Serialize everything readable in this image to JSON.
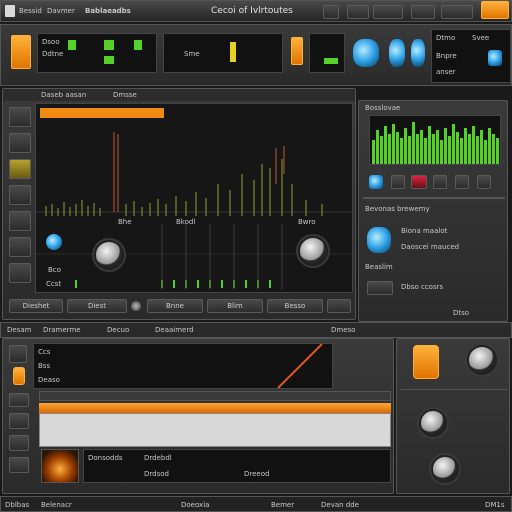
{
  "top_bar": {
    "left_labels": [
      "Bessid",
      "Davmer",
      "Bablaeadbs"
    ],
    "center_title": "Cecoi of Ivlrtoutes"
  },
  "transport": {
    "display_labels": [
      "Dsoo",
      "Ddtne",
      "Sme"
    ],
    "right_display": [
      "Dtmo",
      "Svee",
      "Bnpre",
      "anser"
    ]
  },
  "main_editor": {
    "header_label": "Daseb aasan",
    "header_field": "Dmsse",
    "tab_labels": [
      "Bhe",
      "Bkodl",
      "Bwro"
    ],
    "knob_readouts": [
      "Bco",
      "Ccst"
    ],
    "footer_buttons": [
      "Dieshet",
      "Diest",
      "Bnne",
      "Blim",
      "Besso"
    ]
  },
  "spectrum_panel": {
    "header": "Bosslovae",
    "caption_line1": "Bevonas brewemy",
    "caption_line2": "Biona maalot",
    "caption_line3": "Daoscei mauced",
    "footer_label": "Beaslim",
    "footer_field": "Dbso ccosrs",
    "bottom_label": "Dtso"
  },
  "mixer": {
    "header_labels": [
      "Desam",
      "Dramerme",
      "Decuo",
      "Deaaimerd",
      "Dmeso"
    ],
    "row_labels": [
      "Ccs",
      "Bss",
      "Deaso"
    ],
    "track_labels": [
      "Donsodds",
      "Drdebdl",
      "Drdsod",
      "Dreeod"
    ]
  },
  "bottom_status": {
    "labels": [
      "Dblbas",
      "Belenacr",
      "Doeoxia",
      "Bemer",
      "Devan dde",
      "DM1s"
    ]
  },
  "colors": {
    "accent": "#f08a12",
    "green": "#56d12a",
    "blue": "#2ba0e6"
  }
}
